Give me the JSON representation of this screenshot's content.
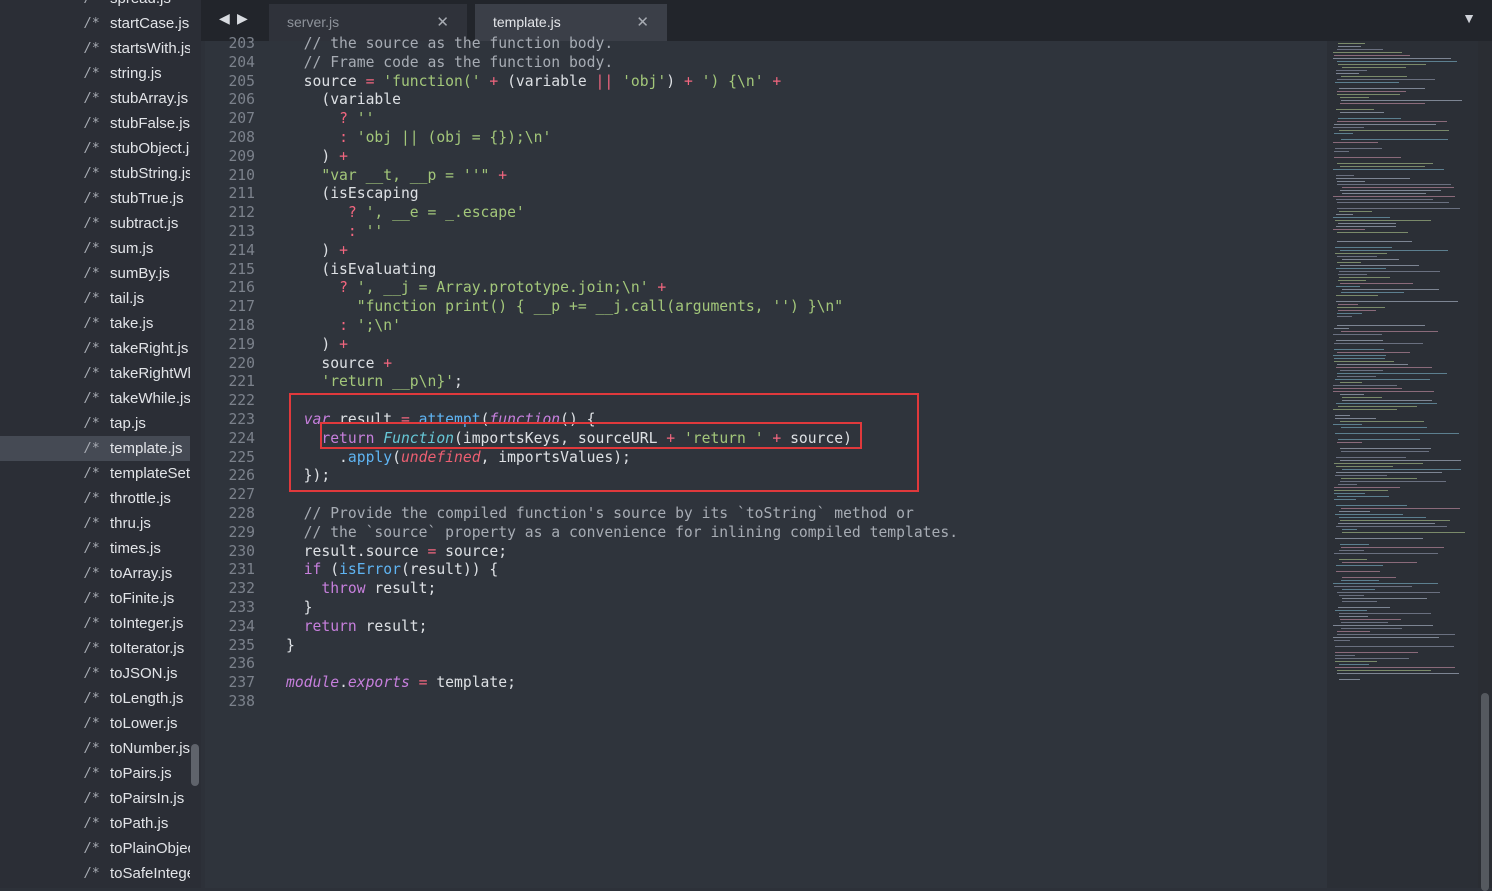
{
  "sidebar": {
    "files": [
      {
        "icon": "/*",
        "name": "spread.js"
      },
      {
        "icon": "/*",
        "name": "startCase.js"
      },
      {
        "icon": "/*",
        "name": "startsWith.js"
      },
      {
        "icon": "/*",
        "name": "string.js"
      },
      {
        "icon": "/*",
        "name": "stubArray.js"
      },
      {
        "icon": "/*",
        "name": "stubFalse.js"
      },
      {
        "icon": "/*",
        "name": "stubObject.js"
      },
      {
        "icon": "/*",
        "name": "stubString.js"
      },
      {
        "icon": "/*",
        "name": "stubTrue.js"
      },
      {
        "icon": "/*",
        "name": "subtract.js"
      },
      {
        "icon": "/*",
        "name": "sum.js"
      },
      {
        "icon": "/*",
        "name": "sumBy.js"
      },
      {
        "icon": "/*",
        "name": "tail.js"
      },
      {
        "icon": "/*",
        "name": "take.js"
      },
      {
        "icon": "/*",
        "name": "takeRight.js"
      },
      {
        "icon": "/*",
        "name": "takeRightWhile.js"
      },
      {
        "icon": "/*",
        "name": "takeWhile.js"
      },
      {
        "icon": "/*",
        "name": "tap.js"
      },
      {
        "icon": "/*",
        "name": "template.js",
        "active": true
      },
      {
        "icon": "/*",
        "name": "templateSettings.js"
      },
      {
        "icon": "/*",
        "name": "throttle.js"
      },
      {
        "icon": "/*",
        "name": "thru.js"
      },
      {
        "icon": "/*",
        "name": "times.js"
      },
      {
        "icon": "/*",
        "name": "toArray.js"
      },
      {
        "icon": "/*",
        "name": "toFinite.js"
      },
      {
        "icon": "/*",
        "name": "toInteger.js"
      },
      {
        "icon": "/*",
        "name": "toIterator.js"
      },
      {
        "icon": "/*",
        "name": "toJSON.js"
      },
      {
        "icon": "/*",
        "name": "toLength.js"
      },
      {
        "icon": "/*",
        "name": "toLower.js"
      },
      {
        "icon": "/*",
        "name": "toNumber.js"
      },
      {
        "icon": "/*",
        "name": "toPairs.js"
      },
      {
        "icon": "/*",
        "name": "toPairsIn.js"
      },
      {
        "icon": "/*",
        "name": "toPath.js"
      },
      {
        "icon": "/*",
        "name": "toPlainObject.js"
      },
      {
        "icon": "/*",
        "name": "toSafeInteger.js"
      }
    ]
  },
  "tabs": {
    "back_arrow": "◀",
    "forward_arrow": "▶",
    "items": [
      {
        "label": "server.js",
        "close": "✕",
        "active": false
      },
      {
        "label": "template.js",
        "close": "✕",
        "active": true
      }
    ],
    "overflow_caret": "▼"
  },
  "editor": {
    "lines": [
      {
        "num": "203",
        "tokens": [
          [
            "cm",
            "  // the source as the function body."
          ]
        ]
      },
      {
        "num": "204",
        "tokens": [
          [
            "cm",
            "  // Frame code as the function body."
          ]
        ]
      },
      {
        "num": "205",
        "tokens": [
          [
            "",
            "  source "
          ],
          [
            "op",
            "="
          ],
          [
            "",
            " "
          ],
          [
            "str",
            "'function('"
          ],
          [
            "",
            " "
          ],
          [
            "op",
            "+"
          ],
          [
            "",
            " (variable "
          ],
          [
            "op",
            "||"
          ],
          [
            "",
            " "
          ],
          [
            "str",
            "'obj'"
          ],
          [
            "",
            ") "
          ],
          [
            "op",
            "+"
          ],
          [
            "",
            " "
          ],
          [
            "str",
            "') {\\n'"
          ],
          [
            "",
            " "
          ],
          [
            "op",
            "+"
          ]
        ]
      },
      {
        "num": "206",
        "tokens": [
          [
            "",
            "    (variable"
          ]
        ]
      },
      {
        "num": "207",
        "tokens": [
          [
            "",
            "      "
          ],
          [
            "op",
            "?"
          ],
          [
            "",
            " "
          ],
          [
            "str",
            "''"
          ]
        ]
      },
      {
        "num": "208",
        "tokens": [
          [
            "",
            "      "
          ],
          [
            "op",
            ":"
          ],
          [
            "",
            " "
          ],
          [
            "str",
            "'obj || (obj = {});\\n'"
          ]
        ]
      },
      {
        "num": "209",
        "tokens": [
          [
            "",
            "    ) "
          ],
          [
            "op",
            "+"
          ]
        ]
      },
      {
        "num": "210",
        "tokens": [
          [
            "",
            "    "
          ],
          [
            "str",
            "\"var __t, __p = ''\""
          ],
          [
            "",
            " "
          ],
          [
            "op",
            "+"
          ]
        ]
      },
      {
        "num": "211",
        "tokens": [
          [
            "",
            "    (isEscaping"
          ]
        ]
      },
      {
        "num": "212",
        "tokens": [
          [
            "",
            "       "
          ],
          [
            "op",
            "?"
          ],
          [
            "",
            " "
          ],
          [
            "str",
            "', __e = _.escape'"
          ]
        ]
      },
      {
        "num": "213",
        "tokens": [
          [
            "",
            "       "
          ],
          [
            "op",
            ":"
          ],
          [
            "",
            " "
          ],
          [
            "str",
            "''"
          ]
        ]
      },
      {
        "num": "214",
        "tokens": [
          [
            "",
            "    ) "
          ],
          [
            "op",
            "+"
          ]
        ]
      },
      {
        "num": "215",
        "tokens": [
          [
            "",
            "    (isEvaluating"
          ]
        ]
      },
      {
        "num": "216",
        "tokens": [
          [
            "",
            "      "
          ],
          [
            "op",
            "?"
          ],
          [
            "",
            " "
          ],
          [
            "str",
            "', __j = Array.prototype.join;\\n'"
          ],
          [
            "",
            " "
          ],
          [
            "op",
            "+"
          ]
        ]
      },
      {
        "num": "217",
        "tokens": [
          [
            "",
            "        "
          ],
          [
            "str",
            "\"function print() { __p += __j.call(arguments, '') }\\n\""
          ]
        ]
      },
      {
        "num": "218",
        "tokens": [
          [
            "",
            "      "
          ],
          [
            "op",
            ":"
          ],
          [
            "",
            " "
          ],
          [
            "str",
            "';\\n'"
          ]
        ]
      },
      {
        "num": "219",
        "tokens": [
          [
            "",
            "    ) "
          ],
          [
            "op",
            "+"
          ]
        ]
      },
      {
        "num": "220",
        "tokens": [
          [
            "",
            "    source "
          ],
          [
            "op",
            "+"
          ]
        ]
      },
      {
        "num": "221",
        "tokens": [
          [
            "",
            "    "
          ],
          [
            "str",
            "'return __p\\n}'"
          ],
          [
            "",
            ";"
          ]
        ]
      },
      {
        "num": "222",
        "tokens": []
      },
      {
        "num": "223",
        "tokens": [
          [
            "",
            "  "
          ],
          [
            "kw",
            "var"
          ],
          [
            "",
            " result "
          ],
          [
            "op",
            "="
          ],
          [
            "",
            " "
          ],
          [
            "fn",
            "attempt"
          ],
          [
            "",
            "("
          ],
          [
            "kw",
            "function"
          ],
          [
            "",
            "() {"
          ]
        ]
      },
      {
        "num": "224",
        "tokens": [
          [
            "",
            "    "
          ],
          [
            "kwp",
            "return"
          ],
          [
            "",
            " "
          ],
          [
            "cls",
            "Function"
          ],
          [
            "",
            "(importsKeys, sourceURL "
          ],
          [
            "op",
            "+"
          ],
          [
            "",
            " "
          ],
          [
            "str",
            "'return '"
          ],
          [
            "",
            " "
          ],
          [
            "op",
            "+"
          ],
          [
            "",
            " source)"
          ]
        ]
      },
      {
        "num": "225",
        "tokens": [
          [
            "",
            "      ."
          ],
          [
            "fn",
            "apply"
          ],
          [
            "",
            "("
          ],
          [
            "und",
            "undefined"
          ],
          [
            "",
            ", importsValues);"
          ]
        ]
      },
      {
        "num": "226",
        "tokens": [
          [
            "",
            "  });"
          ]
        ]
      },
      {
        "num": "227",
        "tokens": []
      },
      {
        "num": "228",
        "tokens": [
          [
            "cm",
            "  // Provide the compiled function's source by its `toString` method or"
          ]
        ]
      },
      {
        "num": "229",
        "tokens": [
          [
            "cm",
            "  // the `source` property as a convenience for inlining compiled templates."
          ]
        ]
      },
      {
        "num": "230",
        "tokens": [
          [
            "",
            "  result.source "
          ],
          [
            "op",
            "="
          ],
          [
            "",
            " source;"
          ]
        ]
      },
      {
        "num": "231",
        "tokens": [
          [
            "",
            "  "
          ],
          [
            "kwp",
            "if"
          ],
          [
            "",
            " ("
          ],
          [
            "fn",
            "isError"
          ],
          [
            "",
            "(result)) {"
          ]
        ]
      },
      {
        "num": "232",
        "tokens": [
          [
            "",
            "    "
          ],
          [
            "kwp",
            "throw"
          ],
          [
            "",
            " result;"
          ]
        ]
      },
      {
        "num": "233",
        "tokens": [
          [
            "",
            "  }"
          ]
        ]
      },
      {
        "num": "234",
        "tokens": [
          [
            "",
            "  "
          ],
          [
            "kwp",
            "return"
          ],
          [
            "",
            " result;"
          ]
        ]
      },
      {
        "num": "235",
        "tokens": [
          [
            "",
            "}"
          ]
        ]
      },
      {
        "num": "236",
        "tokens": []
      },
      {
        "num": "237",
        "tokens": [
          [
            "kw",
            "module"
          ],
          [
            "",
            "."
          ],
          [
            "kw",
            "exports"
          ],
          [
            "",
            " "
          ],
          [
            "op",
            "="
          ],
          [
            "",
            " template;"
          ]
        ]
      },
      {
        "num": "238",
        "tokens": []
      }
    ]
  },
  "colors": {
    "annotation_box": "#e0393c",
    "string": "#a3c77a",
    "operator": "#f2667f",
    "keyword": "#c67fdc",
    "function": "#5fb4f2",
    "comment": "#a7acb4"
  }
}
